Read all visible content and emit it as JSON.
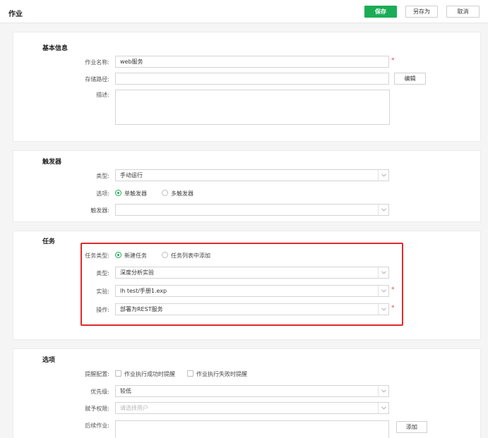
{
  "header": {
    "title": "作业",
    "save_label": "保存",
    "save_as_label": "另存为",
    "cancel_label": "取消"
  },
  "basic": {
    "title": "基本信息",
    "name_label": "作业名称:",
    "name_value": "web服务",
    "path_label": "存储路径:",
    "path_value": "",
    "edit_label": "编辑",
    "desc_label": "描述:"
  },
  "trigger": {
    "title": "触发器",
    "type_label": "类型:",
    "type_value": "手动运行",
    "option_label": "选项:",
    "option_single": "单触发器",
    "option_multi": "多触发器",
    "trigger_label": "触发器:",
    "trigger_value": ""
  },
  "task": {
    "title": "任务",
    "task_type_label": "任务类型:",
    "task_type_new": "新建任务",
    "task_type_from_list": "任务列表中添加",
    "type_label": "类型:",
    "type_value": "深度分析实验",
    "experiment_label": "实验:",
    "experiment_value": "lh test/手册1.exp",
    "operation_label": "操作:",
    "operation_value": "部署为REST服务"
  },
  "options": {
    "title": "选项",
    "alert_label": "提醒配置:",
    "alert_success": "作业执行成功时提醒",
    "alert_fail": "作业执行失败时提醒",
    "priority_label": "优先级:",
    "priority_value": "较低",
    "permission_label": "赋予权限:",
    "permission_placeholder": "请选择用户",
    "followup_label": "后续作业:",
    "add_label": "添加"
  },
  "colors": {
    "primary": "#1aad55",
    "highlight": "#e02b2b",
    "required": "#e04848"
  }
}
